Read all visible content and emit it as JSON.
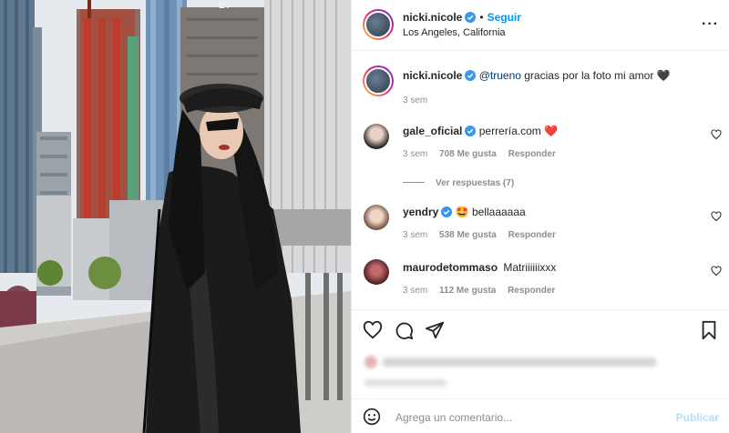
{
  "header": {
    "username": "nicki.nicole",
    "follow_label": "Seguir",
    "location": "Los Angeles, California",
    "separator": "•"
  },
  "caption": {
    "username": "nicki.nicole",
    "mention": "@trueno",
    "text": " gracias por la foto mi amor 🖤",
    "time": "3 sem"
  },
  "comments": [
    {
      "username": "gale_oficial",
      "text": "perrería.com ❤️",
      "time": "3 sem",
      "likes": "708 Me gusta",
      "reply": "Responder",
      "verified": true
    },
    {
      "username": "yendry",
      "text": "🤩 bellaaaaaa",
      "time": "3 sem",
      "likes": "538 Me gusta",
      "reply": "Responder",
      "verified": true
    },
    {
      "username": "maurodetommaso",
      "text": "Matriiiiiixxx",
      "time": "3 sem",
      "likes": "112 Me gusta",
      "reply": "Responder",
      "verified": false
    }
  ],
  "view_replies": "Ver respuestas (7)",
  "add_comment": {
    "placeholder": "Agrega un comentario...",
    "publish_label": "Publicar"
  },
  "photo": {
    "signage_text": "EY"
  },
  "colors": {
    "accent": "#0095f6",
    "verified": "#3897f0",
    "heart": "#ed4956"
  }
}
